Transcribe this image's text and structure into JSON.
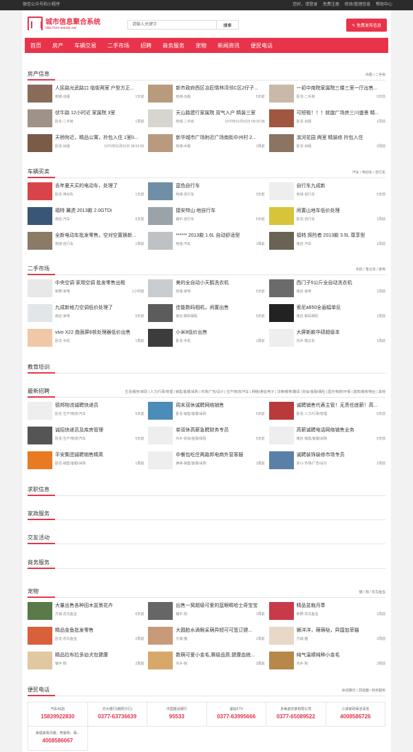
{
  "topbar": {
    "left": "微信公众号和小程序",
    "links": [
      "您好，请登录",
      "免费注册",
      "修改/管理信息",
      "帮助中心"
    ]
  },
  "logo": {
    "name": "城市信息聚合系统",
    "url": "http://cim.wandu.net"
  },
  "search": {
    "placeholder": "请输入关键字",
    "button": "搜索"
  },
  "post_button": "免费发布信息",
  "nav": [
    "首页",
    "房产",
    "车辆交易",
    "二手市场",
    "招聘",
    "商务服务",
    "宠物",
    "新闻资讯",
    "便民电话"
  ],
  "colors": {
    "accent": "#e8334a"
  },
  "sections": [
    {
      "title": "房产信息",
      "more": "出租 / 二手房",
      "items": [
        {
          "title": "人民路光武路口 临街两室 户型方正...",
          "cat": "宛城-出租",
          "time": "1天前",
          "color": "#8a6b5a"
        },
        {
          "title": "新市政府西区冶匠情林湾邻C区2仔子...",
          "cat": "宛城-出租",
          "time": "5天前",
          "color": "#b89a7c"
        },
        {
          "title": "一初中南院家属院三楼三室一厅出售...",
          "cat": "卧龙-二手房",
          "time": "5天前",
          "color": "#c9b9a8"
        },
        {
          "title": "伏牛路 12小时近 家属院 3室",
          "cat": "卧龙-二手房",
          "time": "1周前",
          "color": "#9e9289"
        },
        {
          "title": "天山路建行家属院 双气入户 精装三室",
          "cat": "宛城-二手房",
          "time": "1970年01月01日 08:33:38",
          "color": "#d8d4cf"
        },
        {
          "title": "可短租！！！就旋广场房三川盛景 精...",
          "cat": "卧龙-出租",
          "time": "1周前",
          "color": "#a1563f"
        },
        {
          "title": "天桥附近，精品公寓，拎包入住 1室0...",
          "cat": "卧龙-出租",
          "time": "1970年01月01日 08:52:50",
          "color": "#7a5b48"
        },
        {
          "title": "新华城市广场附近广场南街中州村 2...",
          "cat": "宛城-出租",
          "time": "1周前",
          "color": "#b99a7e"
        },
        {
          "title": "滨河花园 两室 精装修 拎包入住",
          "cat": "卧龙-出租",
          "time": "2周前",
          "color": "#8c7463"
        }
      ]
    },
    {
      "title": "车辆买卖",
      "more": "汽车 / 电动车 / 自行车",
      "items": [
        {
          "title": "去年夏天买的电动车，处理了",
          "cat": "卧龙-电动车",
          "time": "1天前",
          "color": "#d9444a"
        },
        {
          "title": "蓝色自行车",
          "cat": "宛城-自行车",
          "time": "3天前",
          "color": "#6f8fa6"
        },
        {
          "title": "自行车九成新",
          "cat": "宛城-自行车",
          "time": "5天前",
          "color": "#eeeeee"
        },
        {
          "title": "福特 翼虎 2013款 2.0GTDi",
          "cat": "南召-汽车",
          "time": "5天前",
          "color": "#3a5677"
        },
        {
          "title": "捷安特山 地自行车",
          "cat": "镇平-自行车",
          "time": "5天前",
          "color": "#9aa3a8"
        },
        {
          "title": "闲置山地车低价处理",
          "cat": "卧龙-自行车",
          "time": "1周前",
          "color": "#d8c43a"
        },
        {
          "title": "全新电动车批发零售，空对空置换新...",
          "cat": "宛城-自行车",
          "time": "1周前",
          "color": "#8a7a66"
        },
        {
          "title": "****** 2013款 1.6L 自动舒适型",
          "cat": "宛城-汽车",
          "time": "1周前",
          "color": "#bfc2c4"
        },
        {
          "title": "福特 探险者 2013款 3.5L 尊享型",
          "cat": "南召-汽车",
          "time": "1周前",
          "color": "#6a6254"
        }
      ]
    },
    {
      "title": "二手市场",
      "more": "手机 / 笔记本 / 家电",
      "items": [
        {
          "title": "中央空调 家用空调 批发零售出租",
          "cat": "新野-家电",
          "time": "1小时前",
          "color": "#e8e8e8"
        },
        {
          "title": "美的全自动小天鹅洗衣机",
          "cat": "宛城-家电",
          "time": "5天前",
          "color": "#c8cdd2"
        },
        {
          "title": "西门子5公斤全自动洗衣机",
          "cat": "南召-家电",
          "time": "1周前",
          "color": "#6b6b6b"
        },
        {
          "title": "九成新格力空调低价处理了",
          "cat": "南召-家电",
          "time": "5天前",
          "color": "#e2e6e8"
        },
        {
          "title": "佳能数码相机，闲置出售",
          "cat": "南召-数码相机",
          "time": "5天前",
          "color": "#5c5c5c"
        },
        {
          "title": "索尼a850全画幅单反",
          "cat": "南召-数码相机",
          "time": "1周前",
          "color": "#222222"
        },
        {
          "title": "vivo X22 曲面屏8核处理器低价出售",
          "cat": "卧龙-手机",
          "time": "1周前",
          "color": "#f0c8a8"
        },
        {
          "title": "小米8低价出售",
          "cat": "卧龙-手机",
          "time": "1周前",
          "color": "#3c3c3c"
        },
        {
          "title": "大屏新款华硕超级本",
          "cat": "内乡-笔记本",
          "time": "1周前",
          "color": "#eeeeee"
        }
      ]
    },
    {
      "title": "教育培训",
      "more": "",
      "items": []
    },
    {
      "title": "最新招聘",
      "more": "生活/服务/家政 | 人力/行政/管理 | 销售/客服/采购 | 市场/广告/设计 | 生产/物流/汽车 | 网络/通信/电子 | 法律/教育/翻译 | 财会/金融/保险 | 医疗/制药/环保 | 建筑/装修/物业 | 其他",
      "items": [
        {
          "title": "德邦物流诚聘快递员",
          "cat": "卧龙-生产/物流/汽车",
          "time": "5天前",
          "color": "#eeeeee"
        },
        {
          "title": "周末双休诚聘网络销售",
          "cat": "卧龙-销售/客服/采购",
          "time": "5天前",
          "color": "#4a8db8"
        },
        {
          "title": "诚聘销售代表主管！无责任底薪！高...",
          "cat": "卧龙-人力/行政/管理",
          "time": "5天前",
          "color": "#b93a3a"
        },
        {
          "title": "诚招快递员及库房管理",
          "cat": "卧龙-生产/物流/汽车",
          "time": "5天前",
          "color": "#555555"
        },
        {
          "title": "单双休高薪急聘财务专员",
          "cat": "内乡-财会/金融/保险",
          "time": "5天前",
          "color": "#eeeeee"
        },
        {
          "title": "高薪诚聘电话网络销售业务",
          "cat": "南召-销售/客服/采购",
          "time": "6天前",
          "color": "#eeeeee"
        },
        {
          "title": "平安集团诚聘销售精英",
          "cat": "卧龙-销售/客服/采购",
          "time": "1周前",
          "color": "#e87a22"
        },
        {
          "title": "中餐包吃住两路邦电商外营客服",
          "cat": "西峡-销售/客服/采购",
          "time": "1周前",
          "color": "#eeeeee"
        },
        {
          "title": "诚聘装饰装修市场专员",
          "cat": "淅川-市场/广告/设计",
          "time": "1周前",
          "color": "#5a7fa8"
        }
      ]
    },
    {
      "title": "求职信息",
      "more": "",
      "items": []
    },
    {
      "title": "家政服务",
      "more": "",
      "items": []
    },
    {
      "title": "交友活动",
      "more": "",
      "items": []
    },
    {
      "title": "商务服务",
      "more": "",
      "items": []
    },
    {
      "title": "宠物",
      "more": "猫 / 狗 / 花鸟鱼虫",
      "items": [
        {
          "title": "大量出售各种田木盆景花卉",
          "cat": "方城-花鸟鱼虫",
          "time": "6天前",
          "color": "#5a7a4a"
        },
        {
          "title": "出售一窝超级可爱的蓝眼睛哈士奇宝宝",
          "cat": "镇平-狗",
          "time": "1周前",
          "color": "#666666"
        },
        {
          "title": "精品盆栽月季",
          "cat": "新野-花鸟鱼虫",
          "time": "1周前",
          "color": "#c83a4a"
        },
        {
          "title": "精品金鱼批发零售",
          "cat": "卧龙-花鸟鱼虫",
          "time": "2周前",
          "color": "#d8603a"
        },
        {
          "title": "大圆脸水滴眼呆萌异短可可签订健...",
          "cat": "方城-猫",
          "time": "1周前",
          "color": "#c89a7a"
        },
        {
          "title": "狮洋洋，萌萌哒，异国加菲猫",
          "cat": "方城-猫",
          "time": "2周前",
          "color": "#e8d8c8"
        },
        {
          "title": "精品拉布拉多幼犬包健康",
          "cat": "镇平-狗",
          "time": "2周前",
          "color": "#e0c8a0"
        },
        {
          "title": "数萌可爱小金毛,赛级品质,健康血统...",
          "cat": "内乡-狗",
          "time": "2周前",
          "color": "#d8a86a"
        },
        {
          "title": "纯气温顺纯种小金毛",
          "cat": "内乡-狗",
          "time": "2周前",
          "color": "#b8884a"
        }
      ]
    },
    {
      "title": "便民电话",
      "more": "休闲娱乐 / 洞道器 / 商务服务",
      "phones": [
        {
          "name": "汽车4S店",
          "num": "15839922830"
        },
        {
          "name": "光大银行(南阳分行)",
          "num": "0377-63736639"
        },
        {
          "name": "中国建设银行",
          "num": "95533"
        },
        {
          "name": "温钻KTV",
          "num": "0377-63995666"
        },
        {
          "name": "多美姿饮食有限公司",
          "num": "0377-65089522"
        },
        {
          "name": "小潇家政保洁清洗",
          "num": "4008586726"
        },
        {
          "name": "幸福家政月嫂，育婴师，保...",
          "num": "4008586067"
        }
      ]
    }
  ]
}
